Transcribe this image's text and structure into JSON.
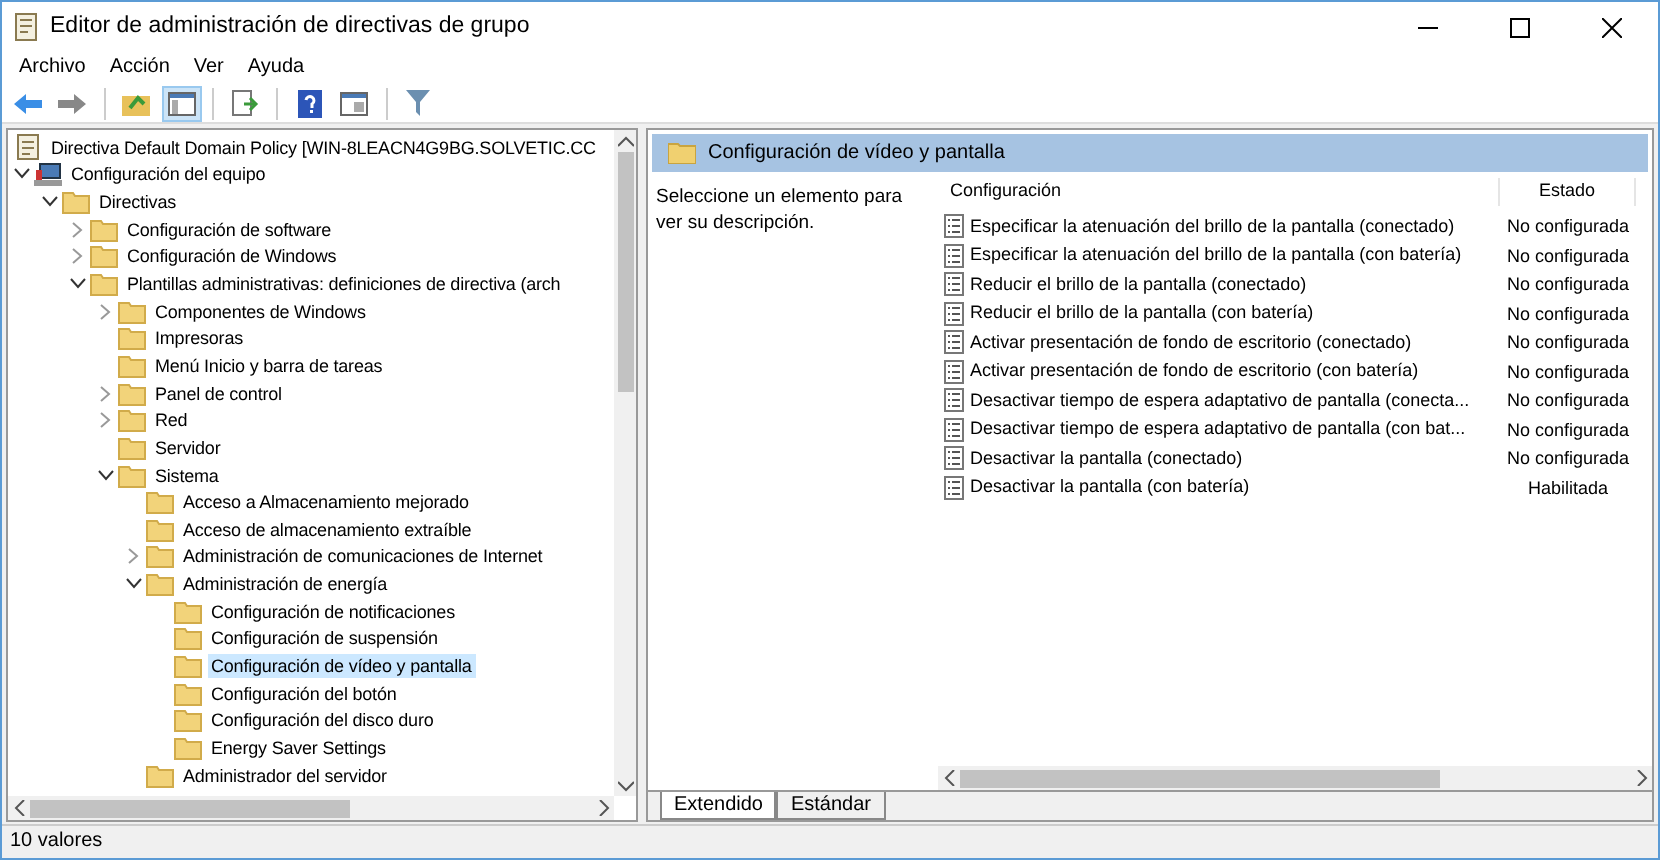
{
  "window": {
    "title": "Editor de administración de directivas de grupo"
  },
  "menu": [
    "Archivo",
    "Acción",
    "Ver",
    "Ayuda"
  ],
  "tree": [
    {
      "label": "Directiva Default Domain Policy [WIN-8LEACN4G9BG.SOLVETIC.CC",
      "kind": "policy",
      "selected": false,
      "children": [
        {
          "label": "Configuración del equipo",
          "kind": "computer",
          "expanded": true,
          "selected": false,
          "children": [
            {
              "label": "Directivas",
              "kind": "folder",
              "expanded": true,
              "selected": false,
              "children": [
                {
                  "label": "Configuración de software",
                  "kind": "folder",
                  "expanded": false,
                  "selected": false
                },
                {
                  "label": "Configuración de Windows",
                  "kind": "folder",
                  "expanded": false,
                  "selected": false
                },
                {
                  "label": "Plantillas administrativas: definiciones de directiva (arch",
                  "kind": "folder",
                  "expanded": true,
                  "selected": false,
                  "children": [
                    {
                      "label": "Componentes de Windows",
                      "kind": "folder",
                      "expanded": false,
                      "selected": false
                    },
                    {
                      "label": "Impresoras",
                      "kind": "folder",
                      "selected": false
                    },
                    {
                      "label": "Menú Inicio y barra de tareas",
                      "kind": "folder",
                      "selected": false
                    },
                    {
                      "label": "Panel de control",
                      "kind": "folder",
                      "expanded": false,
                      "selected": false
                    },
                    {
                      "label": "Red",
                      "kind": "folder",
                      "expanded": false,
                      "selected": false
                    },
                    {
                      "label": "Servidor",
                      "kind": "folder",
                      "selected": false
                    },
                    {
                      "label": "Sistema",
                      "kind": "folder",
                      "expanded": true,
                      "selected": false,
                      "children": [
                        {
                          "label": "Acceso a Almacenamiento mejorado",
                          "kind": "folder",
                          "selected": false
                        },
                        {
                          "label": "Acceso de almacenamiento extraíble",
                          "kind": "folder",
                          "selected": false
                        },
                        {
                          "label": "Administración de comunicaciones de Internet",
                          "kind": "folder",
                          "expanded": false,
                          "selected": false
                        },
                        {
                          "label": "Administración de energía",
                          "kind": "folder",
                          "expanded": true,
                          "selected": false,
                          "children": [
                            {
                              "label": "Configuración de notificaciones",
                              "kind": "folder",
                              "selected": false
                            },
                            {
                              "label": "Configuración de suspensión",
                              "kind": "folder",
                              "selected": false
                            },
                            {
                              "label": "Configuración de vídeo y pantalla",
                              "kind": "folder",
                              "selected": true
                            },
                            {
                              "label": "Configuración del botón",
                              "kind": "folder",
                              "selected": false
                            },
                            {
                              "label": "Configuración del disco duro",
                              "kind": "folder",
                              "selected": false
                            },
                            {
                              "label": "Energy Saver Settings",
                              "kind": "folder",
                              "selected": false
                            }
                          ]
                        },
                        {
                          "label": "Administrador del servidor",
                          "kind": "folder",
                          "selected": false
                        }
                      ]
                    }
                  ]
                }
              ]
            }
          ]
        }
      ]
    }
  ],
  "details": {
    "title": "Configuración de vídeo y pantalla",
    "description": "Seleccione un elemento para ver su descripción.",
    "columns": [
      "Configuración",
      "Estado"
    ],
    "rows": [
      {
        "setting": "Especificar la atenuación del brillo de la pantalla (conectado)",
        "state": "No configurada"
      },
      {
        "setting": "Especificar la atenuación del brillo de la pantalla (con batería)",
        "state": "No configurada"
      },
      {
        "setting": "Reducir el brillo de la pantalla (conectado)",
        "state": "No configurada"
      },
      {
        "setting": "Reducir el brillo de la pantalla (con batería)",
        "state": "No configurada"
      },
      {
        "setting": "Activar presentación de fondo de escritorio (conectado)",
        "state": "No configurada"
      },
      {
        "setting": "Activar presentación de fondo de escritorio (con batería)",
        "state": "No configurada"
      },
      {
        "setting": "Desactivar tiempo de espera adaptativo de pantalla (conecta...",
        "state": "No configurada"
      },
      {
        "setting": "Desactivar tiempo de espera adaptativo de pantalla (con bat...",
        "state": "No configurada"
      },
      {
        "setting": "Desactivar la pantalla (conectado)",
        "state": "No configurada"
      },
      {
        "setting": "Desactivar la pantalla (con batería)",
        "state": "Habilitada"
      }
    ],
    "tabs": [
      {
        "label": "Extendido",
        "selected": true
      },
      {
        "label": "Estándar",
        "selected": false
      }
    ]
  },
  "status_bar": "10 valores"
}
